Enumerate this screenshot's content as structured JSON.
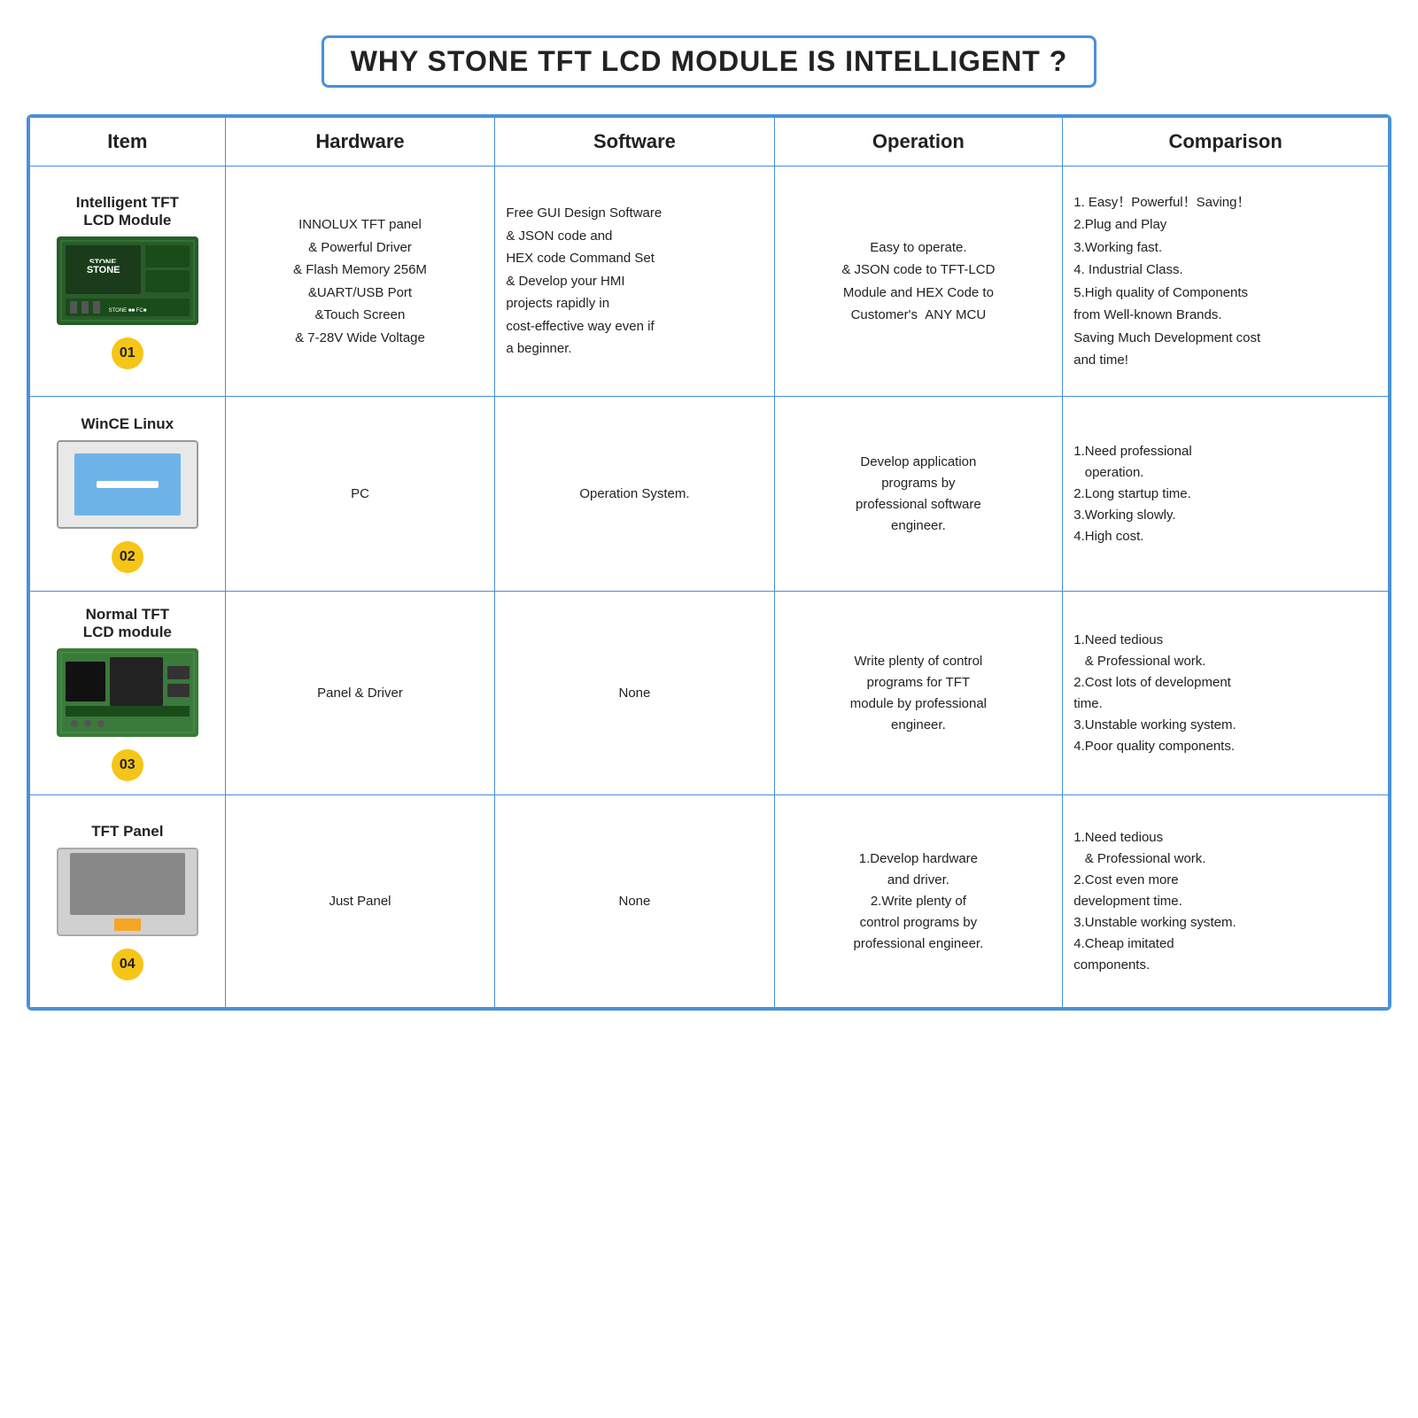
{
  "title": "WHY STONE TFT LCD MODULE IS INTELLIGENT ?",
  "table": {
    "headers": [
      "Item",
      "Hardware",
      "Software",
      "Operation",
      "Comparison"
    ],
    "rows": [
      {
        "id": "01",
        "item_name": "Intelligent TFT\nLCD Module",
        "hardware": "INNOLUX TFT panel\n& Powerful Driver\n& Flash Memory 256M\n&UART/USB Port\n&Touch Screen\n& 7-28V Wide Voltage",
        "software": "Free GUI Design Software\n& JSON code and\nHEX code Command Set\n& Develop your HMI\nprojects rapidly in\ncost-effective way even if\na beginner.",
        "operation": "Easy to operate.\n& JSON code to TFT-LCD\nModule and HEX Code to\nCustomer's  ANY MCU",
        "comparison": "1. Easy！Powerful！Saving！\n2.Plug and Play\n3.Working fast.\n4. Industrial Class.\n5.High quality of Components\nfrom Well-known Brands.\nSaving Much Development cost\nand time!"
      },
      {
        "id": "02",
        "item_name": "WinCE Linux",
        "hardware": "PC",
        "software": "Operation System.",
        "operation": "Develop application\nprograms by\nprofessional software\nengineer.",
        "comparison": "1.Need professional\n   operation.\n2.Long startup time.\n3.Working slowly.\n4.High cost."
      },
      {
        "id": "03",
        "item_name": "Normal TFT\nLCD module",
        "hardware": "Panel & Driver",
        "software": "None",
        "operation": "Write plenty of control\nprograms for TFT\nmodule by professional\nengineer.",
        "comparison": "1.Need tedious\n   & Professional work.\n2.Cost lots of development\ntime.\n3.Unstable working system.\n4.Poor quality components."
      },
      {
        "id": "04",
        "item_name": "TFT Panel",
        "hardware": "Just Panel",
        "software": "None",
        "operation": "1.Develop hardware\nand driver.\n2.Write plenty of\ncontrol programs by\nprofessional engineer.",
        "comparison": "1.Need tedious\n   & Professional work.\n2.Cost even more\ndevelopment time.\n3.Unstable working system.\n4.Cheap imitated\ncomponents."
      }
    ]
  }
}
